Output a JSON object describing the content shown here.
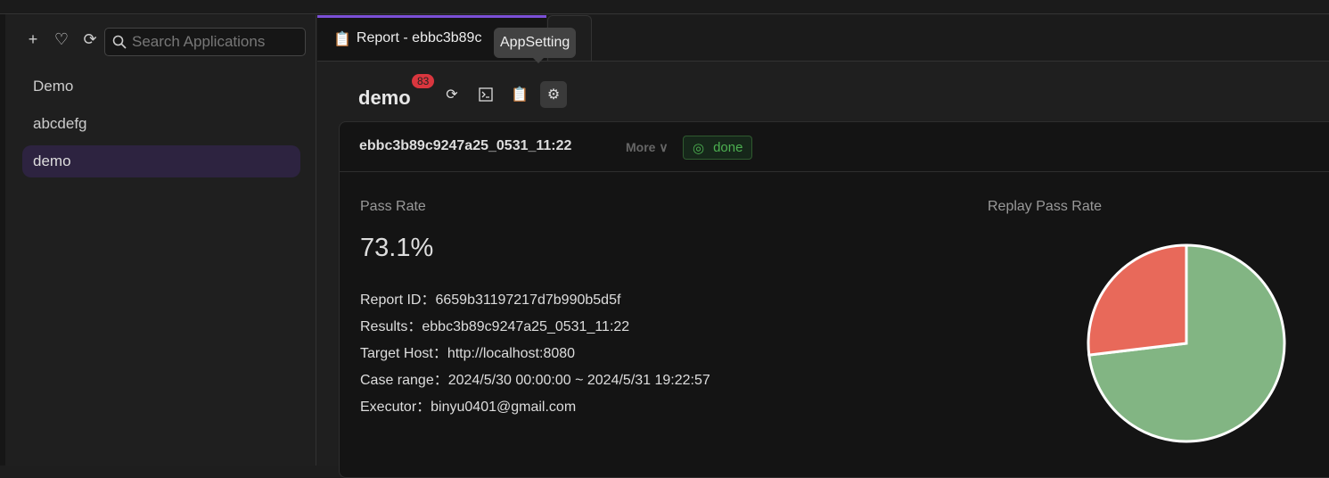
{
  "sidebar": {
    "search_placeholder": "Search Applications",
    "apps": [
      {
        "label": "Demo"
      },
      {
        "label": "abcdefg"
      },
      {
        "label": "demo",
        "active": true
      }
    ]
  },
  "tabs": [
    {
      "label": "Report - ebbc3b89c"
    }
  ],
  "app": {
    "title": "demo",
    "badge": "83",
    "tooltip": "AppSetting"
  },
  "report": {
    "name": "ebbc3b89c9247a25_0531_11:22",
    "more": "More",
    "status": "done",
    "pass_rate_label": "Pass Rate",
    "pass_rate": "73.1%",
    "replay_label": "Replay Pass Rate",
    "info": [
      {
        "k": "Report ID",
        "v": "6659b31197217d7b990b5d5f"
      },
      {
        "k": "Results",
        "v": "ebbc3b89c9247a25_0531_11:22"
      },
      {
        "k": "Target Host",
        "v": "http://localhost:8080"
      },
      {
        "k": "Case range",
        "v": "2024/5/30 00:00:00 ~ 2024/5/31 19:22:57"
      },
      {
        "k": "Executor",
        "v": "binyu0401@gmail.com"
      }
    ]
  },
  "chart_data": {
    "type": "pie",
    "slices": [
      {
        "value": 73.1,
        "color": "#82b583"
      },
      {
        "value": 26.9,
        "color": "#e8695a"
      }
    ]
  },
  "colors": {
    "accent": "#7b4fd6",
    "success": "#4caf50",
    "badge": "#d9363e"
  }
}
